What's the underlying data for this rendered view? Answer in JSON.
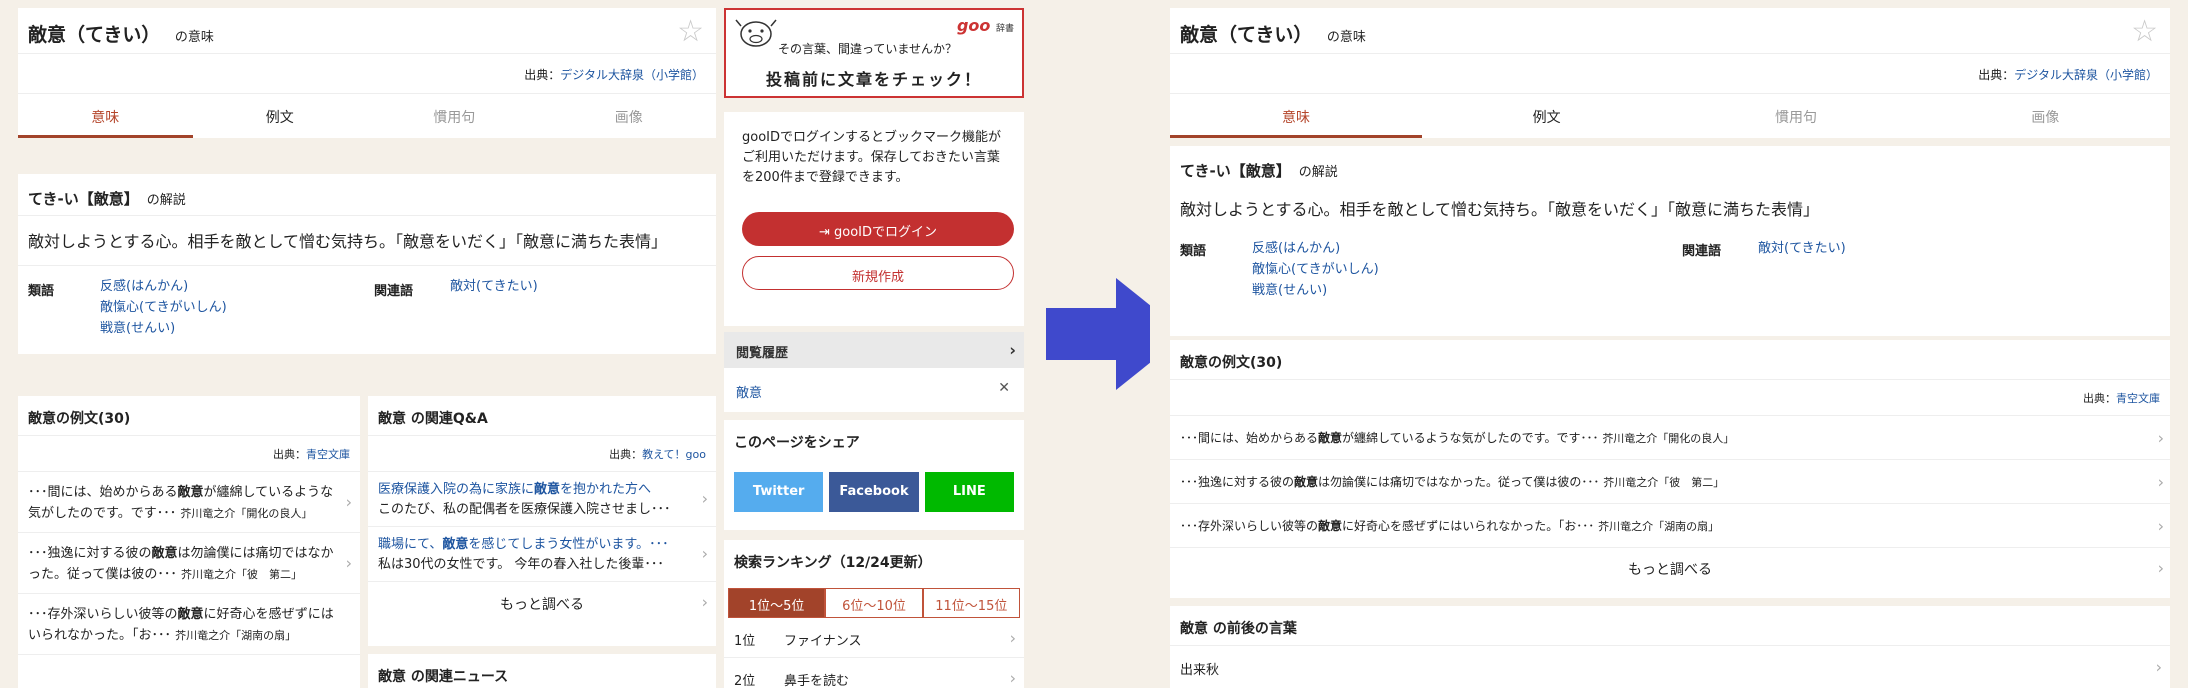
{
  "header": {
    "word": "敵意（てきい）",
    "suffix": "の意味",
    "source_label": "出典：",
    "source_link": "デジタル大辞泉（小学館）"
  },
  "tabs": [
    "意味",
    "例文",
    "慣用句",
    "画像"
  ],
  "explanation": {
    "heading": "てき-い【敵意】",
    "heading_suffix": "の解説",
    "definition": "敵対しようとする心。相手を敵として憎む気持ち。「敵意をいだく」「敵意に満ちた表情」",
    "synonyms_label": "類語",
    "synonyms": [
      "反感(はんかん)",
      "敵愾心(てきがいしん)",
      "戦意(せんい)"
    ],
    "related_label": "関連語",
    "related": [
      "敵対(てきたい)"
    ]
  },
  "examples": {
    "heading": "敵意の例文(30)",
    "source_label": "出典：",
    "source_link": "青空文庫",
    "items_left": [
      {
        "pre": "･･･間には、始めからある",
        "word": "敵意",
        "post": "が纏綿しているような気がしたのです。です･･･",
        "author": "芥川竜之介「開化の良人」"
      },
      {
        "pre": "･･･独逸に対する彼の",
        "word": "敵意",
        "post": "は勿論僕には痛切ではなかった。従って僕は彼の･･･",
        "author": "芥川竜之介「彼　第二」"
      },
      {
        "pre": "･･･存外深いらしい彼等の",
        "word": "敵意",
        "post": "に好奇心を感ぜずにはいられなかった。「お･･･",
        "author": "芥川竜之介「湖南の扇」"
      }
    ],
    "more": "もっと調べる"
  },
  "qa": {
    "heading": "敵意 の関連Q&A",
    "source_label": "出典：",
    "source_link": "教えて！goo",
    "items": [
      {
        "title_pre": "医療保護入院の為に家族に",
        "title_word": "敵意",
        "title_post": "を抱かれた方へ",
        "body": "このたび、私の配偶者を医療保護入院させまし･･･"
      },
      {
        "title_pre": "職場にて、",
        "title_word": "敵意",
        "title_post": "を感じてしまう女性がいます。･･･",
        "body": "私は30代の女性です。 今年の春入社した後輩･･･"
      }
    ],
    "more": "もっと調べる"
  },
  "news": {
    "heading": "敵意 の関連ニュース"
  },
  "ad": {
    "logo": "goo",
    "logo_sub": "辞書",
    "line1": "その言葉、間違っていませんか？",
    "line2": "投稿前に文章をチェック！"
  },
  "login": {
    "text": "gooIDでログインするとブックマーク機能がご利用いただけます。保存しておきたい言葉を200件まで登録できます。",
    "login_button": "gooIDでログイン",
    "register_button": "新規作成"
  },
  "history": {
    "heading": "閲覧履歴",
    "item": "敵意"
  },
  "share": {
    "heading": "このページをシェア",
    "twitter": "Twitter",
    "facebook": "Facebook",
    "line": "LINE"
  },
  "ranking": {
    "heading": "検索ランキング（12/24更新）",
    "tabs": [
      "1位〜5位",
      "6位〜10位",
      "11位〜15位"
    ],
    "rows": [
      {
        "rank": "1位",
        "word": "ファイナンス"
      },
      {
        "rank": "2位",
        "word": "鼻手を読む"
      }
    ]
  },
  "right": {
    "examples_items": [
      {
        "pre": "･･･間には、始めからある",
        "word": "敵意",
        "post": "が纏綿しているような気がしたのです。です･･･",
        "author": "芥川竜之介「開化の良人」"
      },
      {
        "pre": "･･･独逸に対する彼の",
        "word": "敵意",
        "post": "は勿論僕には痛切ではなかった。従って僕は彼の･･･",
        "author": "芥川竜之介「彼　第二」"
      },
      {
        "pre": "･･･存外深いらしい彼等の",
        "word": "敵意",
        "post": "に好奇心を感ぜずにはいられなかった。「お･･･",
        "author": "芥川竜之介「湖南の扇」"
      }
    ],
    "neighbors_heading": "敵意 の前後の言葉",
    "neighbor_item": "出来秋"
  },
  "colors": {
    "accent": "#a2432a",
    "link": "#1e55a0",
    "login_red": "#c33030",
    "twitter": "#55acee",
    "facebook": "#3b5998",
    "line": "#00b900",
    "arrow": "#3f49cc"
  }
}
